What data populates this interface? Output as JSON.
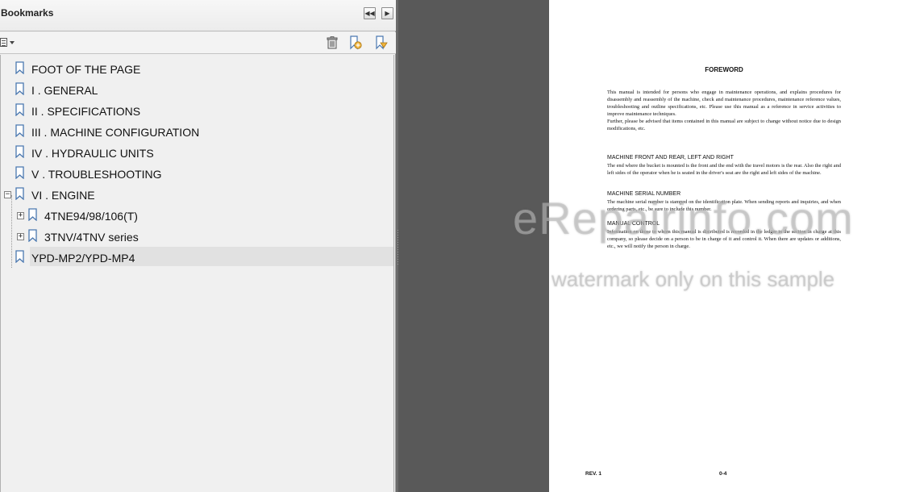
{
  "panel": {
    "title": "Bookmarks",
    "header_buttons": [
      "collapse-panel",
      "next-panel"
    ],
    "toolbar_icons": [
      "options-menu-icon",
      "delete-bookmark-icon",
      "new-bookmark-icon",
      "new-bookmark-from-structure-icon"
    ]
  },
  "bookmarks": [
    {
      "label": "FOOT OF THE PAGE"
    },
    {
      "label": "I . GENERAL"
    },
    {
      "label": "II . SPECIFICATIONS"
    },
    {
      "label": "III . MACHINE CONFIGURATION"
    },
    {
      "label": "IV . HYDRAULIC UNITS"
    },
    {
      "label": "V . TROUBLESHOOTING"
    },
    {
      "label": "VI . ENGINE",
      "expanded": true,
      "expander": "−"
    },
    {
      "label": "4TNE94/98/106(T)",
      "expander": "+"
    },
    {
      "label": "3TNV/4TNV series",
      "expander": "+"
    },
    {
      "label": "YPD-MP2/YPD-MP4",
      "selected": true
    }
  ],
  "document": {
    "title": "FOREWORD",
    "intro": "This manual is intended for persons who engage in maintenance operations, and explains procedures for disassembly and reassembly of the machine, check and maintenance procedures, maintenance reference values, troubleshooting and outline specifications, etc. Please use this manual as a reference in service activities to improve maintenance techniques.",
    "intro2": "Further, please be advised that items contained in this manual are subject to change without notice due to design modifications, etc.",
    "section1_head": "MACHINE FRONT AND REAR, LEFT AND RIGHT",
    "section1_body": "The end where the bucket is mounted is the front and the end with the travel motors is the rear. Also the right and left sides of the operator when he is seated in the driver's seat are the right and left sides of the machine.",
    "section2_head": "MACHINE SERIAL NUMBER",
    "section2_body": "The machine serial number is stamped on the identification plate. When sending reports and inquiries, and when ordering parts, etc., be sure to include this number.",
    "section3_head": "MANUAL CONTROL",
    "section3_body": "Information on those to whom this manual is distributed is recorded in the ledger in the section in charge at this company, so please decide on a person to be in charge of it and control it. When there are updates or additions, etc., we will notify the person in charge.",
    "footer_left": "REV. 1",
    "footer_page": "0-4"
  },
  "watermark": {
    "line1": "eRepairinfo.com",
    "line2": "watermark only on this sample"
  },
  "colors": {
    "panel_bg": "#f0f0f0",
    "viewer_bg": "#595959",
    "selected_row": "#e1e1e1",
    "bookmark_icon": "#4a78b0"
  }
}
